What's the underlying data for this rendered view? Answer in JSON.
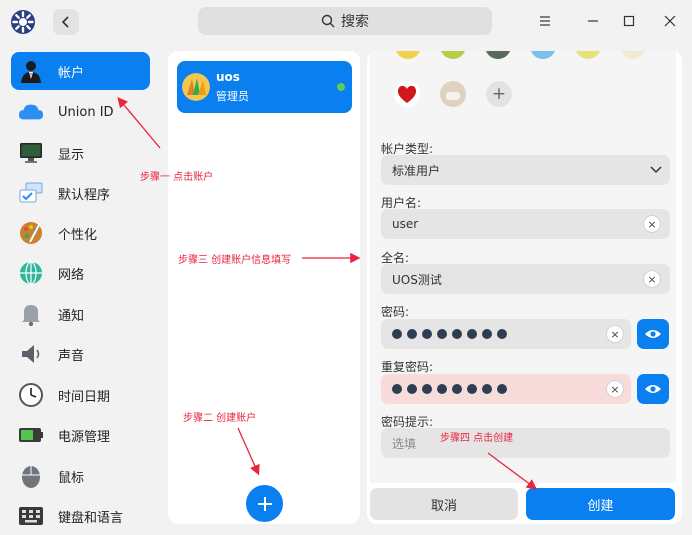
{
  "titlebar": {
    "search_label": "搜索",
    "back_icon": "chevron-left-icon",
    "menu_icon": "menu-icon",
    "minimize_icon": "minimize-icon",
    "maximize_icon": "maximize-icon",
    "close_icon": "close-icon"
  },
  "sidebar": {
    "items": [
      {
        "label": "帐户",
        "icon": "account-icon",
        "active": true
      },
      {
        "label": "Union ID",
        "icon": "cloud-icon"
      },
      {
        "label": "显示",
        "icon": "display-icon"
      },
      {
        "label": "默认程序",
        "icon": "default-apps-icon"
      },
      {
        "label": "个性化",
        "icon": "personalization-icon"
      },
      {
        "label": "网络",
        "icon": "network-icon"
      },
      {
        "label": "通知",
        "icon": "bell-icon"
      },
      {
        "label": "声音",
        "icon": "speaker-icon"
      },
      {
        "label": "时间日期",
        "icon": "clock-icon"
      },
      {
        "label": "电源管理",
        "icon": "battery-icon"
      },
      {
        "label": "鼠标",
        "icon": "mouse-icon"
      },
      {
        "label": "键盘和语言",
        "icon": "keyboard-icon"
      }
    ]
  },
  "users": {
    "current": {
      "name": "uos",
      "role": "管理员",
      "status_color": "#5ecb5a"
    },
    "add_label": "+"
  },
  "form": {
    "account_type_label": "帐户类型:",
    "account_type_value": "标准用户",
    "username_label": "用户名:",
    "username_value": "user",
    "fullname_label": "全名:",
    "fullname_value": "UOS测试",
    "password_label": "密码:",
    "password_dots": 8,
    "repeat_label": "重复密码:",
    "repeat_dots": 8,
    "hint_label": "密码提示:",
    "hint_placeholder": "选填",
    "add_avatar": "+",
    "clear_glyph": "×"
  },
  "buttons": {
    "cancel": "取消",
    "create": "创建"
  },
  "annotations": {
    "step1": "步骤一 点击账户",
    "step2": "步骤二 创建账户",
    "step3": "步骤三 创建账户信息填写",
    "step4": "步骤四 点击创建"
  },
  "colors": {
    "accent": "#0a7ff0",
    "annotation": "#e8253d",
    "error_field": "#f8dcdc"
  }
}
